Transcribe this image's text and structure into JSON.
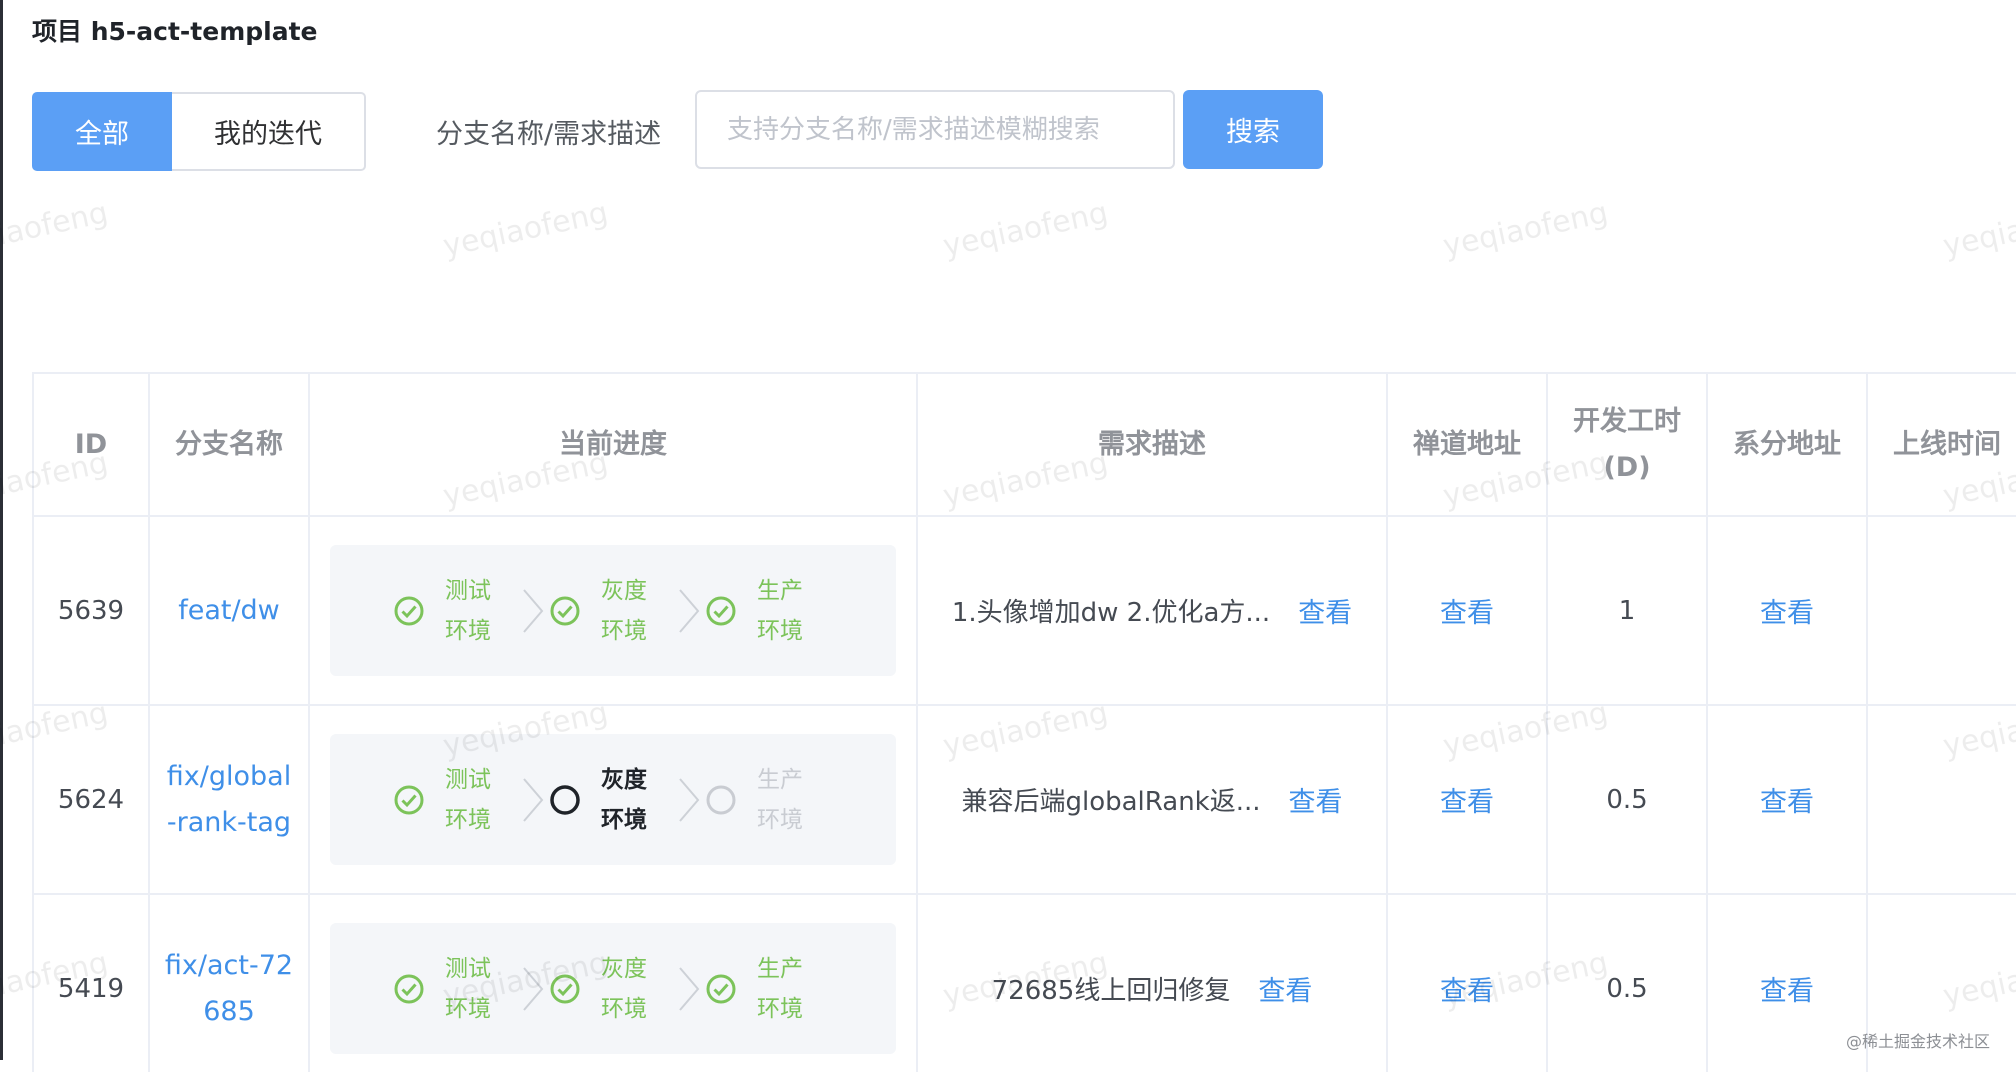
{
  "project": {
    "title": "项目 h5-act-template"
  },
  "filters": {
    "tabs": [
      {
        "label": "全部",
        "active": true
      },
      {
        "label": "我的迭代",
        "active": false
      }
    ],
    "search_label": "分支名称/需求描述",
    "search_placeholder": "支持分支名称/需求描述模糊搜索",
    "search_value": "",
    "search_button": "搜索"
  },
  "table": {
    "headers": {
      "id": "ID",
      "branch": "分支名称",
      "progress": "当前进度",
      "desc": "需求描述",
      "zentao": "禅道地址",
      "hours": "开发工时(D)",
      "xifen": "系分地址",
      "online": "上线时间"
    },
    "rows": [
      {
        "id": "5639",
        "branch": "feat/dw",
        "steps": [
          {
            "label": "测试环境",
            "state": "done"
          },
          {
            "label": "灰度环境",
            "state": "done"
          },
          {
            "label": "生产环境",
            "state": "done"
          }
        ],
        "desc": "1.头像增加dw 2.优化a方...",
        "desc_view": "查看",
        "zentao": "查看",
        "hours": "1",
        "xifen": "查看",
        "online": ""
      },
      {
        "id": "5624",
        "branch": "fix/global-rank-tag",
        "steps": [
          {
            "label": "测试环境",
            "state": "done"
          },
          {
            "label": "灰度环境",
            "state": "current"
          },
          {
            "label": "生产环境",
            "state": "pending"
          }
        ],
        "desc": "兼容后端globalRank返...",
        "desc_view": "查看",
        "zentao": "查看",
        "hours": "0.5",
        "xifen": "查看",
        "online": ""
      },
      {
        "id": "5419",
        "branch": "fix/act-72685",
        "steps": [
          {
            "label": "测试环境",
            "state": "done"
          },
          {
            "label": "灰度环境",
            "state": "done"
          },
          {
            "label": "生产环境",
            "state": "done"
          }
        ],
        "desc": "72685线上回归修复",
        "desc_view": "查看",
        "zentao": "查看",
        "hours": "0.5",
        "xifen": "查看",
        "online": ""
      }
    ]
  },
  "watermark": {
    "text": "yeqiaofeng"
  },
  "corner_mark": "@稀土掘金技术社区",
  "colors": {
    "primary": "#5b9ff5",
    "link": "#3f8fe8",
    "done": "#7cc35a",
    "pending": "#c9ccd2"
  }
}
